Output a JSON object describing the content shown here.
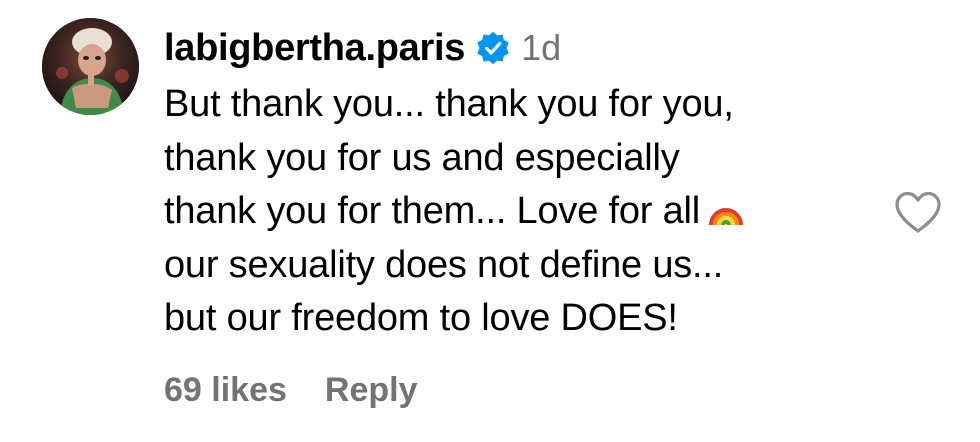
{
  "comment": {
    "username": "labigbertha.paris",
    "verified_icon": "verified-badge-icon",
    "timestamp": "1d",
    "body_lines": [
      "But thank you... thank you for you,",
      "thank you for us and especially",
      "thank you for them... Love for all",
      "our sexuality does not define us...",
      "but our freedom to love DOES!"
    ],
    "emoji": "rainbow-emoji",
    "likes": "69 likes",
    "reply": "Reply",
    "like_icon": "heart-outline-icon"
  },
  "colors": {
    "text": "#000000",
    "secondary": "#737373",
    "verified": "#0095f6",
    "heart_stroke": "#8e8e8e"
  }
}
